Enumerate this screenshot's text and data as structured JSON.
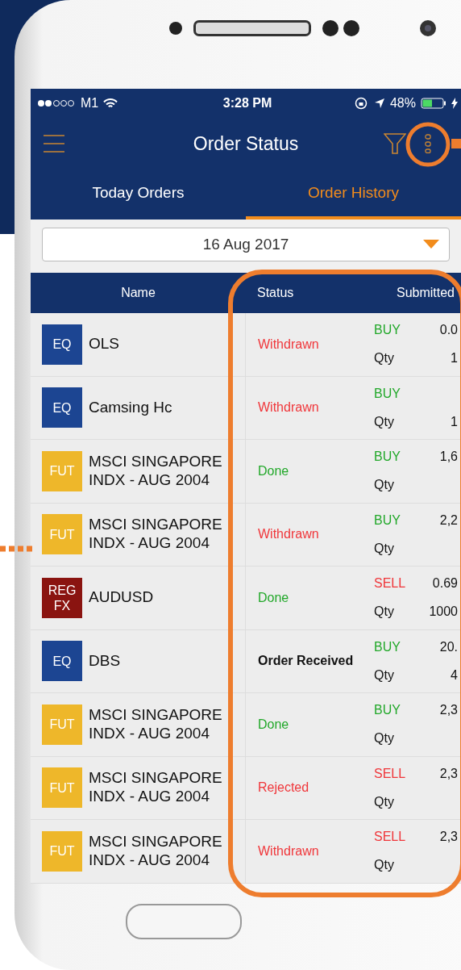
{
  "status_bar": {
    "carrier": "M1",
    "time": "3:28 PM",
    "battery": "48%",
    "battery_meter": {
      "level": 0.48
    }
  },
  "header": {
    "title": "Order Status"
  },
  "tabs": [
    {
      "label": "Today Orders",
      "selected": false
    },
    {
      "label": "Order History",
      "selected": true
    }
  ],
  "date_picker": {
    "value": "16 Aug 2017"
  },
  "table": {
    "columns": [
      "Name",
      "Status",
      "Submitted"
    ],
    "rows": [
      {
        "badge": {
          "label": "EQ",
          "color": "#1c4592"
        },
        "name": "OLS",
        "status": {
          "label": "Withdrawn",
          "kind": "withdrawn"
        },
        "side": {
          "label": "BUY",
          "kind": "buy"
        },
        "price": "0.0",
        "qty_label": "Qty",
        "qty": "1"
      },
      {
        "badge": {
          "label": "EQ",
          "color": "#1c4592"
        },
        "name": "Camsing Hc",
        "status": {
          "label": "Withdrawn",
          "kind": "withdrawn"
        },
        "side": {
          "label": "BUY",
          "kind": "buy"
        },
        "qty_label": "Qty",
        "qty": "1"
      },
      {
        "badge": {
          "label": "FUT",
          "color": "#eeb72a"
        },
        "name": "MSCI SINGAPORE INDX - AUG 2004",
        "status": {
          "label": "Done",
          "kind": "done"
        },
        "side": {
          "label": "BUY",
          "kind": "buy"
        },
        "price": "1,6",
        "qty_label": "Qty"
      },
      {
        "badge": {
          "label": "FUT",
          "color": "#eeb72a"
        },
        "name": "MSCI SINGAPORE INDX - AUG 2004",
        "status": {
          "label": "Withdrawn",
          "kind": "withdrawn"
        },
        "side": {
          "label": "BUY",
          "kind": "buy"
        },
        "price": "2,2",
        "qty_label": "Qty"
      },
      {
        "badge": {
          "label": "REG FX",
          "color": "#8a1410"
        },
        "name": "AUDUSD",
        "status": {
          "label": "Done",
          "kind": "done"
        },
        "side": {
          "label": "SELL",
          "kind": "sell"
        },
        "price": "0.69",
        "qty_label": "Qty",
        "qty": "1000"
      },
      {
        "badge": {
          "label": "EQ",
          "color": "#1c4592"
        },
        "name": "DBS",
        "status": {
          "label": "Order Received",
          "kind": "received"
        },
        "side": {
          "label": "BUY",
          "kind": "buy"
        },
        "price": "20.",
        "qty_label": "Qty",
        "qty": "4"
      },
      {
        "badge": {
          "label": "FUT",
          "color": "#eeb72a"
        },
        "name": "MSCI SINGAPORE INDX - AUG 2004",
        "status": {
          "label": "Done",
          "kind": "done"
        },
        "side": {
          "label": "BUY",
          "kind": "buy"
        },
        "price": "2,3",
        "qty_label": "Qty"
      },
      {
        "badge": {
          "label": "FUT",
          "color": "#eeb72a"
        },
        "name": "MSCI SINGAPORE INDX - AUG 2004",
        "status": {
          "label": "Rejected",
          "kind": "rejected"
        },
        "side": {
          "label": "SELL",
          "kind": "sell"
        },
        "price": "2,3",
        "qty_label": "Qty"
      },
      {
        "badge": {
          "label": "FUT",
          "color": "#eeb72a"
        },
        "name": "MSCI SINGAPORE INDX - AUG 2004",
        "status": {
          "label": "Withdrawn",
          "kind": "withdrawn"
        },
        "side": {
          "label": "SELL",
          "kind": "sell"
        },
        "price": "2,3",
        "qty_label": "Qty"
      }
    ]
  }
}
